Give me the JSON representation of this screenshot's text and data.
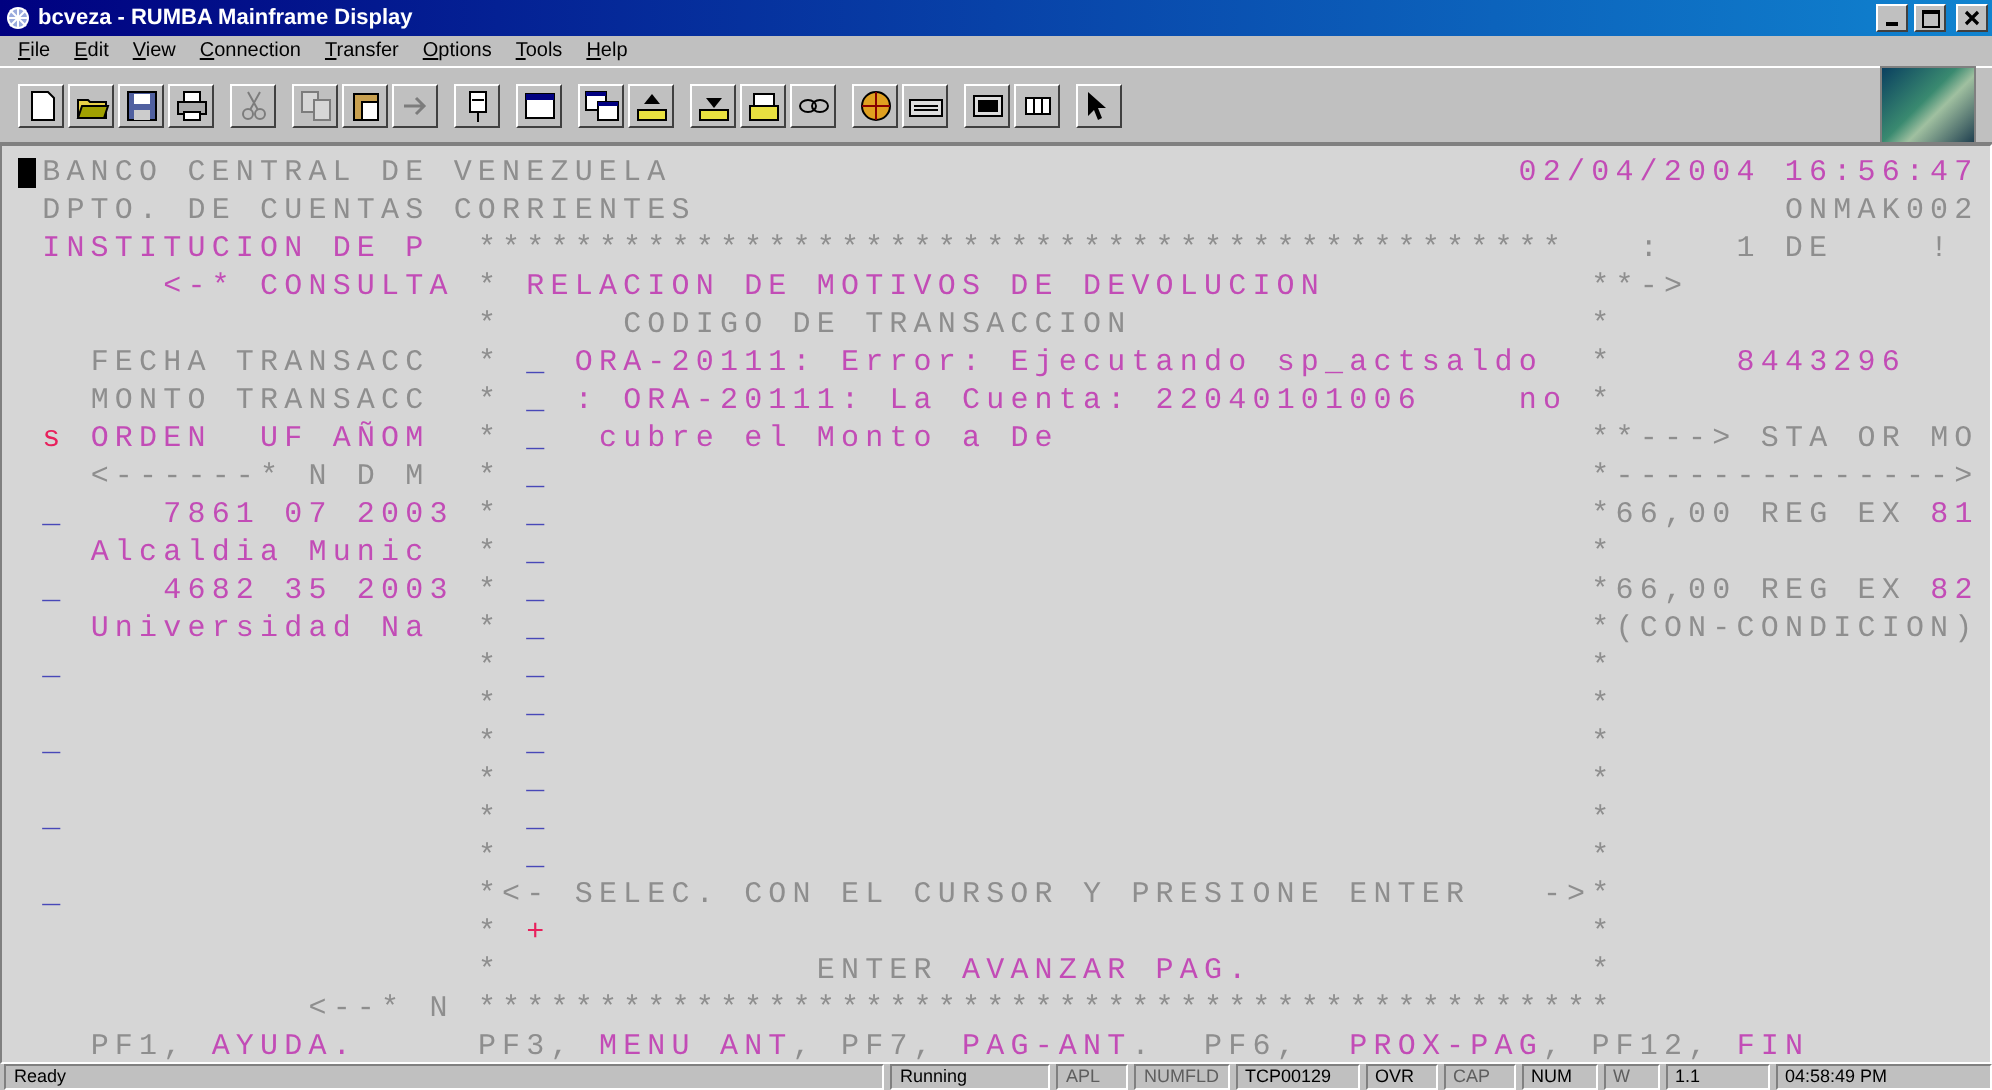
{
  "window": {
    "title": "bcveza - RUMBA Mainframe Display"
  },
  "menu": [
    "File",
    "Edit",
    "View",
    "Connection",
    "Transfer",
    "Options",
    "Tools",
    "Help"
  ],
  "toolbar": [
    {
      "disabled": false
    },
    {
      "disabled": false
    },
    {
      "disabled": false
    },
    {
      "disabled": false
    },
    {
      "disabled": true
    },
    {
      "disabled": true
    },
    {
      "disabled": false
    },
    {
      "disabled": true
    },
    {
      "disabled": false
    },
    {
      "disabled": false
    },
    {
      "disabled": false
    },
    {
      "disabled": false
    },
    {
      "disabled": false
    },
    {
      "disabled": false
    },
    {
      "disabled": false
    },
    {
      "disabled": false
    },
    {
      "disabled": false
    },
    {
      "disabled": false
    },
    {
      "disabled": false
    },
    {
      "disabled": false
    }
  ],
  "terminal": {
    "lines": [
      [
        {
          "kind": "plain",
          "cursor": true,
          "text": " BANCO CENTRAL DE VENEZUELA"
        },
        {
          "kind": "bright",
          "text": "                                   02/04/2004 16:56:47"
        }
      ],
      [
        {
          "kind": "plain",
          "text": " DPTO. DE CUENTAS CORRIENTES"
        },
        {
          "kind": "plain",
          "text": "                                             ONMAK002"
        }
      ],
      [
        {
          "kind": "bright",
          "text": " INSTITUCION DE P"
        },
        {
          "kind": "plain",
          "text": "  *********************************************"
        },
        {
          "kind": "plain",
          "text": "   :   1 DE    !"
        }
      ],
      [
        {
          "kind": "bright",
          "text": "      <-* CONSULTA"
        },
        {
          "kind": "plain",
          "text": " *"
        },
        {
          "kind": "bright",
          "text": " RELACION DE MOTIVOS DE DEVOLUCION"
        },
        {
          "kind": "plain",
          "text": "           **->"
        }
      ],
      [
        {
          "kind": "plain",
          "text": "                   *"
        },
        {
          "kind": "plain",
          "text": "     CODIGO DE TRANSACCION"
        },
        {
          "kind": "plain",
          "text": "                   *"
        }
      ],
      [
        {
          "kind": "plain",
          "text": "   FECHA TRANSACC"
        },
        {
          "kind": "plain",
          "text": "  *"
        },
        {
          "kind": "field",
          "text": " _"
        },
        {
          "kind": "bright",
          "text": " ORA-20111: Error: Ejecutando sp_actsaldo"
        },
        {
          "kind": "plain",
          "text": "  *"
        },
        {
          "kind": "bright",
          "text": "     8443296"
        }
      ],
      [
        {
          "kind": "plain",
          "text": "   MONTO TRANSACC"
        },
        {
          "kind": "plain",
          "text": "  *"
        },
        {
          "kind": "field",
          "text": " _"
        },
        {
          "kind": "bright",
          "text": " : ORA-20111: La Cuenta: 22040101006"
        },
        {
          "kind": "bright",
          "text": "    no"
        },
        {
          "kind": "plain",
          "text": " *"
        }
      ],
      [
        {
          "kind": "alert",
          "text": " s"
        },
        {
          "kind": "bright",
          "text": " ORDEN  UF AÑOM"
        },
        {
          "kind": "plain",
          "text": "  *"
        },
        {
          "kind": "field",
          "text": " _"
        },
        {
          "kind": "bright",
          "text": "  cubre el Monto a De"
        },
        {
          "kind": "plain",
          "text": "                      **---> STA OR MO"
        }
      ],
      [
        {
          "kind": "plain",
          "text": "   <------* N D M"
        },
        {
          "kind": "plain",
          "text": "  *"
        },
        {
          "kind": "field",
          "text": " _"
        },
        {
          "kind": "plain",
          "text": "                                           *-------------->"
        }
      ],
      [
        {
          "kind": "field",
          "text": " _"
        },
        {
          "kind": "bright",
          "text": "    7861 07 2003"
        },
        {
          "kind": "plain",
          "text": " *"
        },
        {
          "kind": "field",
          "text": " _"
        },
        {
          "kind": "plain",
          "text": "                                           *66,00 REG EX"
        },
        {
          "kind": "bright",
          "text": " 81"
        }
      ],
      [
        {
          "kind": "bright",
          "text": "   Alcaldia Munic"
        },
        {
          "kind": "plain",
          "text": "  *"
        },
        {
          "kind": "field",
          "text": " _"
        },
        {
          "kind": "plain",
          "text": "                                           *"
        }
      ],
      [
        {
          "kind": "field",
          "text": " _"
        },
        {
          "kind": "bright",
          "text": "    4682 35 2003"
        },
        {
          "kind": "plain",
          "text": " *"
        },
        {
          "kind": "field",
          "text": " _"
        },
        {
          "kind": "plain",
          "text": "                                           *66,00 REG EX"
        },
        {
          "kind": "bright",
          "text": " 82"
        }
      ],
      [
        {
          "kind": "bright",
          "text": "   Universidad Na"
        },
        {
          "kind": "plain",
          "text": "  *"
        },
        {
          "kind": "field",
          "text": " _"
        },
        {
          "kind": "plain",
          "text": "                                           *(CON-CONDICION)"
        }
      ],
      [
        {
          "kind": "field",
          "text": " _"
        },
        {
          "kind": "plain",
          "text": "                 *"
        },
        {
          "kind": "field",
          "text": " _"
        },
        {
          "kind": "plain",
          "text": "                                           *"
        }
      ],
      [
        {
          "kind": "plain",
          "text": "                   *"
        },
        {
          "kind": "field",
          "text": " _"
        },
        {
          "kind": "plain",
          "text": "                                           *"
        }
      ],
      [
        {
          "kind": "field",
          "text": " _"
        },
        {
          "kind": "plain",
          "text": "                 *"
        },
        {
          "kind": "field",
          "text": " _"
        },
        {
          "kind": "plain",
          "text": "                                           *"
        }
      ],
      [
        {
          "kind": "plain",
          "text": "                   *"
        },
        {
          "kind": "field",
          "text": " _"
        },
        {
          "kind": "plain",
          "text": "                                           *"
        }
      ],
      [
        {
          "kind": "field",
          "text": " _"
        },
        {
          "kind": "plain",
          "text": "                 *"
        },
        {
          "kind": "field",
          "text": " _"
        },
        {
          "kind": "plain",
          "text": "                                           *"
        }
      ],
      [
        {
          "kind": "plain",
          "text": "                   *"
        },
        {
          "kind": "field",
          "text": " _"
        },
        {
          "kind": "plain",
          "text": "                                           *"
        }
      ],
      [
        {
          "kind": "field",
          "text": " _"
        },
        {
          "kind": "plain",
          "text": "                 *<- SELEC. CON EL CURSOR Y PRESIONE ENTER"
        },
        {
          "kind": "plain",
          "text": "   ->*"
        }
      ],
      [
        {
          "kind": "plain",
          "text": "                   *"
        },
        {
          "kind": "alert",
          "text": " +"
        },
        {
          "kind": "plain",
          "text": "                                           *"
        }
      ],
      [
        {
          "kind": "plain",
          "text": "                   *"
        },
        {
          "kind": "plain",
          "text": "             ENTER"
        },
        {
          "kind": "bright",
          "text": " AVANZAR PAG."
        },
        {
          "kind": "plain",
          "text": "              *"
        }
      ],
      [
        {
          "kind": "plain",
          "text": "            <--* N"
        },
        {
          "kind": "plain",
          "text": " ***********************************************"
        }
      ],
      [
        {
          "kind": "plain",
          "text": "   PF1,"
        },
        {
          "kind": "bright",
          "text": " AYUDA."
        },
        {
          "kind": "plain",
          "text": "     PF3,"
        },
        {
          "kind": "bright",
          "text": " MENU ANT"
        },
        {
          "kind": "plain",
          "text": ","
        },
        {
          "kind": "plain",
          "text": " PF7,"
        },
        {
          "kind": "bright",
          "text": " PAG-ANT"
        },
        {
          "kind": "plain",
          "text": "."
        },
        {
          "kind": "plain",
          "text": "  PF6,"
        },
        {
          "kind": "bright",
          "text": "  PROX-PAG"
        },
        {
          "kind": "plain",
          "text": ","
        },
        {
          "kind": "plain",
          "text": " PF12,"
        },
        {
          "kind": "bright",
          "text": " FIN"
        }
      ]
    ]
  },
  "status_bar": [
    {
      "text": "Ready",
      "disabled": false
    },
    {
      "text": "Running",
      "disabled": false
    },
    {
      "text": "APL",
      "disabled": true
    },
    {
      "text": "NUMFLD",
      "disabled": true
    },
    {
      "text": "TCP00129",
      "disabled": false
    },
    {
      "text": "OVR",
      "disabled": false
    },
    {
      "text": "CAP",
      "disabled": true
    },
    {
      "text": "NUM",
      "disabled": false
    },
    {
      "text": "W",
      "disabled": true
    },
    {
      "text": "1.1",
      "disabled": false
    },
    {
      "text": "04:58:49 PM",
      "disabled": false
    }
  ]
}
